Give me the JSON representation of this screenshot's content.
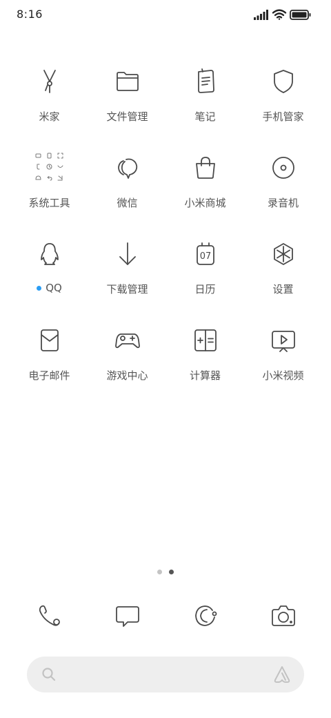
{
  "status_bar": {
    "time": "8:16",
    "icons": [
      "signal-icon",
      "wifi-icon",
      "battery-icon"
    ]
  },
  "apps": [
    {
      "label": "米家",
      "icon": "mijia-icon"
    },
    {
      "label": "文件管理",
      "icon": "folder-icon"
    },
    {
      "label": "笔记",
      "icon": "notes-icon"
    },
    {
      "label": "手机管家",
      "icon": "shield-icon"
    },
    {
      "label": "系统工具",
      "icon": "system-tools-folder-icon"
    },
    {
      "label": "微信",
      "icon": "wechat-icon"
    },
    {
      "label": "小米商城",
      "icon": "shopping-bag-icon"
    },
    {
      "label": "录音机",
      "icon": "recorder-icon"
    },
    {
      "label": "QQ",
      "icon": "qq-penguin-icon",
      "new_indicator": true
    },
    {
      "label": "下载管理",
      "icon": "download-arrow-icon"
    },
    {
      "label": "日历",
      "icon": "calendar-icon",
      "icon_text": "07"
    },
    {
      "label": "设置",
      "icon": "settings-hexagon-icon"
    },
    {
      "label": "电子邮件",
      "icon": "email-icon"
    },
    {
      "label": "游戏中心",
      "icon": "gamepad-icon"
    },
    {
      "label": "计算器",
      "icon": "calculator-icon"
    },
    {
      "label": "小米视频",
      "icon": "video-play-icon"
    }
  ],
  "page_indicator": {
    "count": 2,
    "active": 2
  },
  "dock": [
    "phone-icon",
    "messages-icon",
    "browser-icon",
    "camera-icon"
  ],
  "search_bar": {
    "placeholder": "",
    "value": ""
  },
  "colors": {
    "icon_stroke": "#4a4a4a",
    "label": "#555555",
    "new_dot": "#2a9df4",
    "dot_inactive": "#c4c4c4",
    "dot_active": "#555555",
    "search_bg": "#eeeeee",
    "search_icon": "#c2c2c2"
  }
}
